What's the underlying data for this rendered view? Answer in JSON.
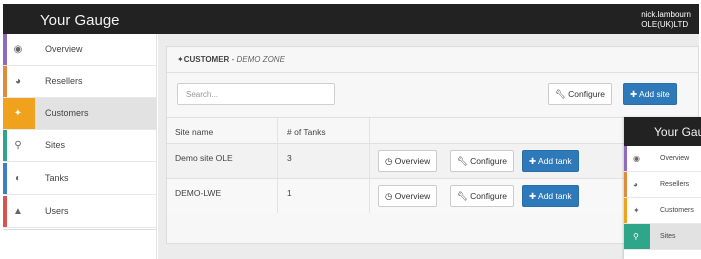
{
  "app": {
    "brand": "Your Gauge",
    "user_name": "nick.lambourn",
    "user_org": "OLE(UK)LTD"
  },
  "sidebar": {
    "items": [
      {
        "label": "Overview",
        "icon": "dashboard-icon",
        "glyph": "◉",
        "accent": "#8e6bbf",
        "active": false
      },
      {
        "label": "Resellers",
        "icon": "globe-icon",
        "glyph": "◕",
        "accent": "#e08a3c",
        "active": false
      },
      {
        "label": "Customers",
        "icon": "users-icon",
        "glyph": "✦",
        "accent": "#f0a21c",
        "active": true
      },
      {
        "label": "Sites",
        "icon": "map-marker-icon",
        "glyph": "⚲",
        "accent": "#2fa58a",
        "active": false
      },
      {
        "label": "Tanks",
        "icon": "tank-icon",
        "glyph": "◐",
        "accent": "#3d7fc2",
        "active": false
      },
      {
        "label": "Users",
        "icon": "user-icon",
        "glyph": "▲",
        "accent": "#d9534f",
        "active": false
      }
    ]
  },
  "panel": {
    "title_prefix": "CUSTOMER",
    "title_sep": " - ",
    "title_context": "DEMO ZONE",
    "search_placeholder": "Search...",
    "configure_label": "Configure",
    "add_site_label": "Add site"
  },
  "table": {
    "columns": [
      "Site name",
      "# of Tanks",
      ""
    ],
    "rows": [
      {
        "site": "Demo site OLE",
        "tanks": "3"
      },
      {
        "site": "DEMO-LWE",
        "tanks": "1"
      }
    ],
    "row_actions": {
      "overview": "Overview",
      "configure": "Configure",
      "add_tank": "Add tank"
    }
  },
  "overlay": {
    "brand": "Your Gauge",
    "items": [
      {
        "label": "Overview",
        "icon": "dashboard-icon",
        "glyph": "◉",
        "accent": "#8e6bbf",
        "active": false
      },
      {
        "label": "Resellers",
        "icon": "globe-icon",
        "glyph": "◕",
        "accent": "#e08a3c",
        "active": false
      },
      {
        "label": "Customers",
        "icon": "users-icon",
        "glyph": "✦",
        "accent": "#f0a21c",
        "active": false
      },
      {
        "label": "Sites",
        "icon": "map-marker-icon",
        "glyph": "⚲",
        "accent": "#2fa58a",
        "active": true
      }
    ]
  },
  "colors": {
    "topbar": "#222222",
    "primary": "#2e79b9"
  }
}
